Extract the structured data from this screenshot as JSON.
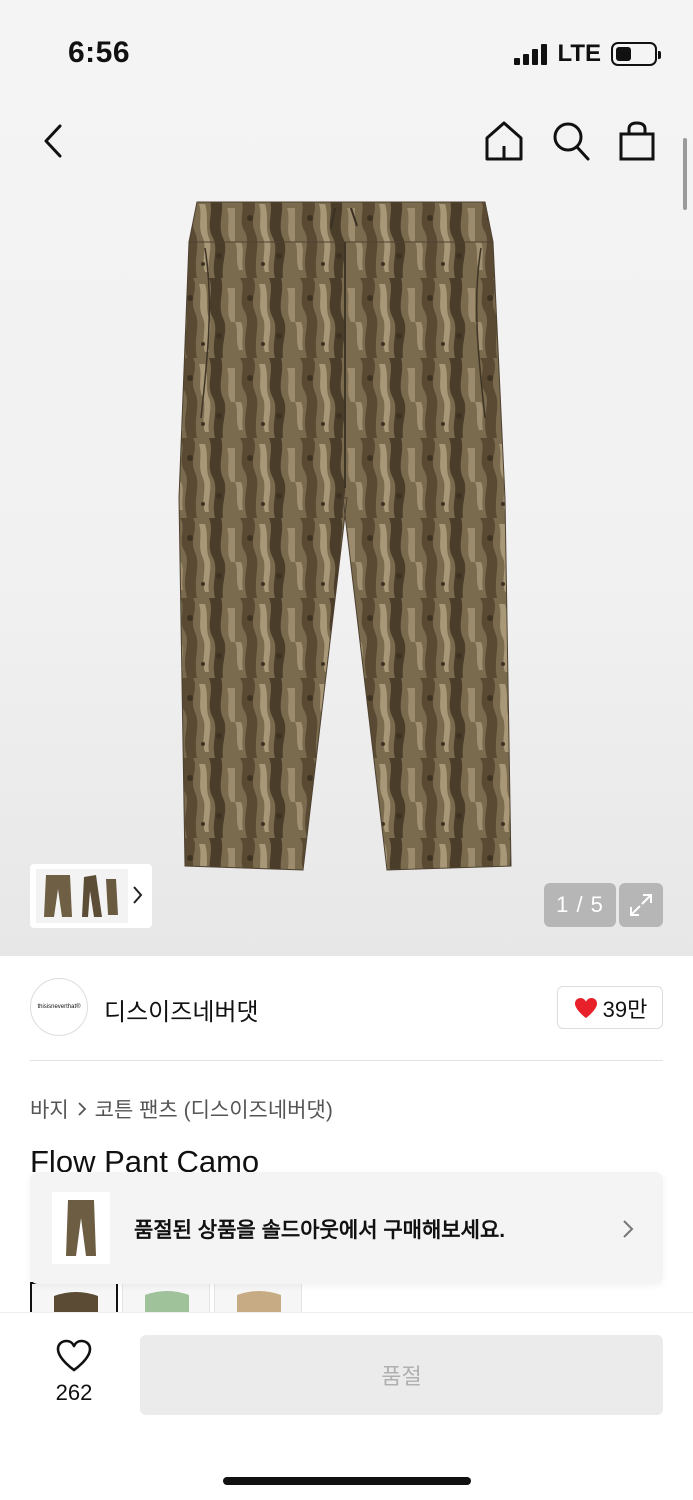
{
  "status_bar": {
    "time": "6:56",
    "network": "LTE"
  },
  "header": {
    "back_icon": "chevron-left-icon",
    "home_icon": "home-icon",
    "search_icon": "search-icon",
    "bag_icon": "shopping-bag-icon"
  },
  "gallery": {
    "page_indicator": "1 / 5",
    "current_page": 1,
    "total_pages": 5,
    "expand_icon": "expand-icon"
  },
  "brand": {
    "logo_text": "thisisneverthat®",
    "name": "디스이즈네버댓",
    "like_count": "39만",
    "like_color": "#e8202a"
  },
  "breadcrumb": {
    "category": "바지",
    "subcategory": "코튼 팬츠 (디스이즈네버댓)"
  },
  "product": {
    "title": "Flow Pant Camo"
  },
  "soldout_banner": {
    "message": "품절된 상품을 솔드아웃에서 구매해보세요."
  },
  "bottom_bar": {
    "wish_count": "262",
    "soldout_label": "품절"
  }
}
